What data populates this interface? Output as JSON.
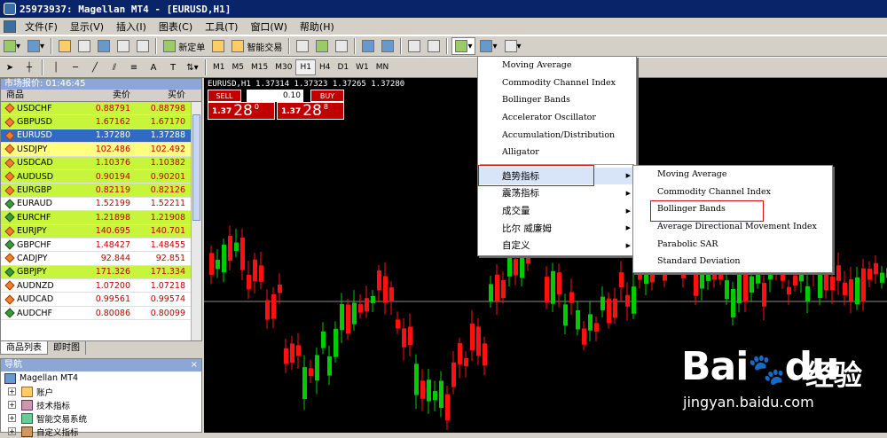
{
  "window": {
    "title": "25973937: Magellan MT4 - [EURUSD,H1]"
  },
  "menubar": [
    "文件(F)",
    "显示(V)",
    "插入(I)",
    "图表(C)",
    "工具(T)",
    "窗口(W)",
    "帮助(H)"
  ],
  "toolbar": {
    "new_order": "新定单",
    "expert": "智能交易"
  },
  "timeframes": [
    "M1",
    "M5",
    "M15",
    "M30",
    "H1",
    "H4",
    "D1",
    "W1",
    "MN"
  ],
  "timeframes_active": "H1",
  "market_watch": {
    "title": "市场报价: 01:46:45",
    "headers": [
      "商品",
      "卖价",
      "买价"
    ],
    "rows": [
      {
        "symbol": "USDCHF",
        "bid": "0.88791",
        "ask": "0.88798"
      },
      {
        "symbol": "GBPUSD",
        "bid": "1.67162",
        "ask": "1.67170"
      },
      {
        "symbol": "EURUSD",
        "bid": "1.37280",
        "ask": "1.37288"
      },
      {
        "symbol": "USDJPY",
        "bid": "102.486",
        "ask": "102.492"
      },
      {
        "symbol": "USDCAD",
        "bid": "1.10376",
        "ask": "1.10382"
      },
      {
        "symbol": "AUDUSD",
        "bid": "0.90194",
        "ask": "0.90201"
      },
      {
        "symbol": "EURGBP",
        "bid": "0.82119",
        "ask": "0.82126"
      },
      {
        "symbol": "EURAUD",
        "bid": "1.52199",
        "ask": "1.52211"
      },
      {
        "symbol": "EURCHF",
        "bid": "1.21898",
        "ask": "1.21908"
      },
      {
        "symbol": "EURJPY",
        "bid": "140.695",
        "ask": "140.701"
      },
      {
        "symbol": "GBPCHF",
        "bid": "1.48427",
        "ask": "1.48455"
      },
      {
        "symbol": "CADJPY",
        "bid": "92.844",
        "ask": "92.851"
      },
      {
        "symbol": "GBPJPY",
        "bid": "171.326",
        "ask": "171.334"
      },
      {
        "symbol": "AUDNZD",
        "bid": "1.07200",
        "ask": "1.07218"
      },
      {
        "symbol": "AUDCAD",
        "bid": "0.99561",
        "ask": "0.99574"
      },
      {
        "symbol": "AUDCHF",
        "bid": "0.80086",
        "ask": "0.80099"
      }
    ],
    "tabs": [
      "商品列表",
      "即时图"
    ]
  },
  "navigator": {
    "title": "导航",
    "close": "×",
    "items": [
      "Magellan MT4",
      "账户",
      "技术指标",
      "智能交易系统",
      "自定义指标"
    ]
  },
  "chart": {
    "label": "EURUSD,H1  1.37314 1.37323 1.37265 1.37280",
    "sell": "SELL",
    "buy": "BUY",
    "lot": "0.10",
    "sell_price_small": "1.37",
    "sell_price_big": "28",
    "sell_price_sup": "0",
    "buy_price_small": "1.37",
    "buy_price_big": "28",
    "buy_price_sup": "8"
  },
  "indicator_menu": {
    "items": [
      "Moving Average",
      "Commodity Channel Index",
      "Bollinger Bands",
      "Accelerator Oscillator",
      "Accumulation/Distribution",
      "Alligator"
    ],
    "categories": [
      "趋势指标",
      "震荡指标",
      "成交量",
      "比尔 威廉姆",
      "自定义"
    ]
  },
  "trend_submenu": {
    "items": [
      "Moving Average",
      "Commodity Channel Index",
      "Bollinger Bands",
      "Average Directional Movement Index",
      "Parabolic SAR",
      "Standard Deviation"
    ]
  },
  "watermark": {
    "brand": "Bai",
    "brand2": "du",
    "jingyan": "经验",
    "url": "jingyan.baidu.com"
  }
}
